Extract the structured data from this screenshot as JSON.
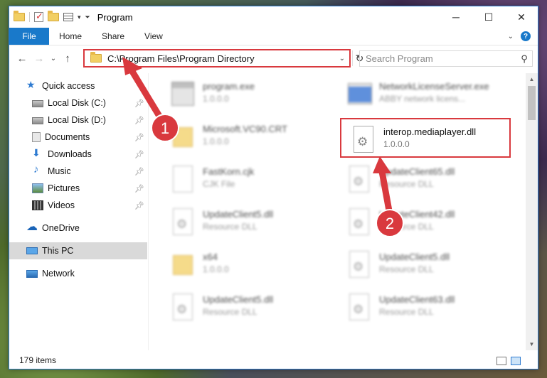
{
  "window": {
    "title": "Program",
    "controls": {
      "minimize": "─",
      "maximize": "☐",
      "close": "✕"
    }
  },
  "ribbon": {
    "tabs": [
      "File",
      "Home",
      "Share",
      "View"
    ],
    "help": "?"
  },
  "address": {
    "path": "C:\\Program Files\\Program Directory",
    "search_placeholder": "Search Program"
  },
  "sidebar": {
    "items": [
      {
        "label": "Quick access",
        "icon": "star-icon"
      },
      {
        "label": "Local Disk (C:)",
        "icon": "disk-icon",
        "pinned": true
      },
      {
        "label": "Local Disk (D:)",
        "icon": "disk-icon",
        "pinned": true
      },
      {
        "label": "Documents",
        "icon": "documents-icon",
        "pinned": true
      },
      {
        "label": "Downloads",
        "icon": "downloads-icon",
        "pinned": true
      },
      {
        "label": "Music",
        "icon": "music-icon",
        "pinned": true
      },
      {
        "label": "Pictures",
        "icon": "pictures-icon",
        "pinned": true
      },
      {
        "label": "Videos",
        "icon": "videos-icon",
        "pinned": true
      },
      {
        "label": "OneDrive",
        "icon": "cloud-icon"
      },
      {
        "label": "This PC",
        "icon": "computer-icon",
        "selected": true
      },
      {
        "label": "Network",
        "icon": "network-icon"
      }
    ]
  },
  "files": [
    {
      "name": "program.exe",
      "sub": "1.0.0.0",
      "icon": "exe-icon"
    },
    {
      "name": "NetworkLicenseServer.exe",
      "sub": "ABBY network licens...",
      "icon": "exe-blue-icon"
    },
    {
      "name": "Microsoft.VC90.CRT",
      "sub": "1.0.0.0",
      "icon": "folder-icon"
    },
    {
      "name": "interop.mediaplayer.dll",
      "sub": "1.0.0.0",
      "icon": "dll-icon",
      "highlighted": true
    },
    {
      "name": "FastKorn.cjk",
      "sub": "CJK File",
      "icon": "file-icon"
    },
    {
      "name": "UpdateClient65.dll",
      "sub": "Resource DLL",
      "icon": "dll-icon"
    },
    {
      "name": "UpdateClient5.dll",
      "sub": "Resource DLL",
      "icon": "dll-icon"
    },
    {
      "name": "UpdateClient42.dll",
      "sub": "Resource DLL",
      "icon": "dll-icon"
    },
    {
      "name": "x64",
      "sub": "1.0.0.0",
      "icon": "folder-icon"
    },
    {
      "name": "UpdateClient5.dll",
      "sub": "Resource DLL",
      "icon": "dll-icon"
    },
    {
      "name": "UpdateClient5.dll",
      "sub": "Resource DLL",
      "icon": "dll-icon"
    },
    {
      "name": "UpdateClient63.dll",
      "sub": "Resource DLL",
      "icon": "dll-icon"
    }
  ],
  "status": {
    "item_count": "179 items"
  },
  "annotations": {
    "step1": "1",
    "step2": "2"
  },
  "colors": {
    "accent": "#1979ca",
    "annotation_red": "#d9393e"
  }
}
